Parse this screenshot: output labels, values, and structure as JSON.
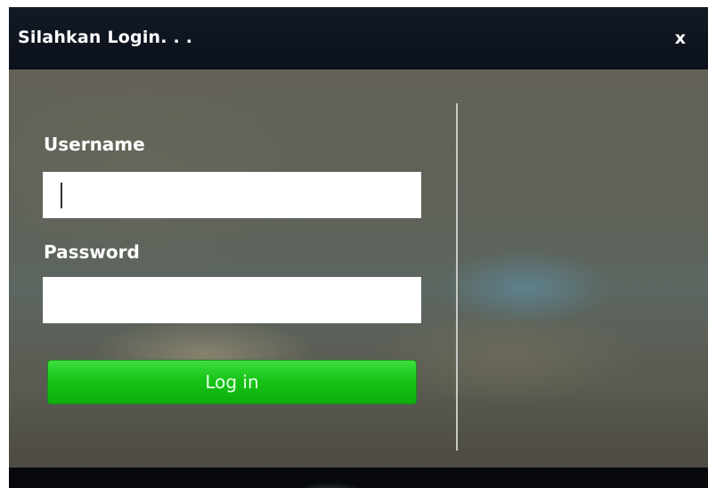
{
  "dialog": {
    "title": "Silahkan Login. . .",
    "close_label": "x"
  },
  "form": {
    "username_label": "Username",
    "username_value": "",
    "password_label": "Password",
    "password_value": "",
    "login_button_label": "Log in"
  },
  "colors": {
    "titlebar": "#0b111a",
    "login_button": "#18c418",
    "text": "#ffffff"
  }
}
